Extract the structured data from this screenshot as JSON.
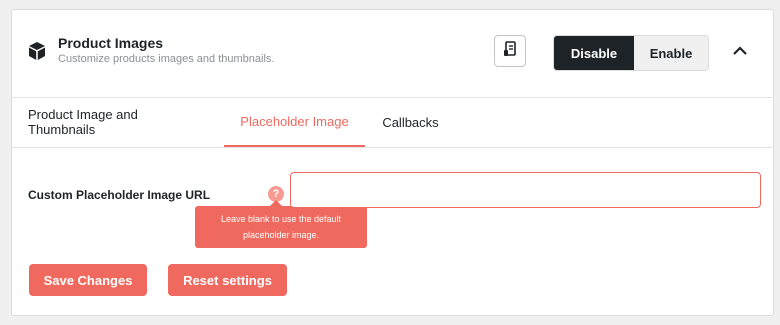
{
  "header": {
    "icon": "box-icon",
    "title": "Product Images",
    "subtitle": "Customize products images and thumbnails.",
    "doc_icon": "document-icon",
    "toggle": {
      "disable_label": "Disable",
      "enable_label": "Enable",
      "selected": "Disable"
    },
    "collapse_icon": "chevron-up-icon"
  },
  "tabs": [
    {
      "label": "Product Image and Thumbnails",
      "active": false
    },
    {
      "label": "Placeholder Image",
      "active": true
    },
    {
      "label": "Callbacks",
      "active": false
    }
  ],
  "form": {
    "field_label": "Custom Placeholder Image URL",
    "help_icon": "?",
    "tooltip_line1": "Leave blank to use the default",
    "tooltip_line2": "placeholder image.",
    "input_value": ""
  },
  "actions": {
    "save_label": "Save Changes",
    "reset_label": "Reset settings"
  },
  "colors": {
    "accent": "#f0695e",
    "dark": "#1d2327",
    "muted": "#8c8f94"
  }
}
